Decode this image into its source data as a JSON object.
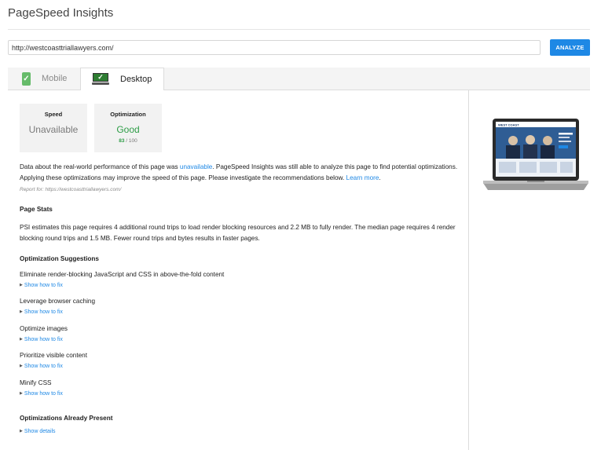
{
  "header": {
    "title": "PageSpeed Insights"
  },
  "search": {
    "url": "http://westcoasttriallawyers.com/",
    "analyze_label": "ANALYZE"
  },
  "tabs": {
    "mobile": "Mobile",
    "desktop": "Desktop"
  },
  "scores": {
    "speed": {
      "title": "Speed",
      "value": "Unavailable"
    },
    "optimization": {
      "title": "Optimization",
      "value": "Good",
      "score": "83",
      "max": "/ 100"
    }
  },
  "intro": {
    "part1": "Data about the real-world performance of this page was ",
    "link1": "unavailable",
    "part2": ". PageSpeed Insights was still able to analyze this page to find potential optimizations. Applying these optimizations may improve the speed of this page. Please investigate the recommendations below. ",
    "link2": "Learn more",
    "part3": "."
  },
  "report_for": "Report for: https://westcoasttriallawyers.com/",
  "page_stats": {
    "heading": "Page Stats",
    "text": "PSI estimates this page requires 4 additional round trips to load render blocking resources and 2.2 MB to fully render. The median page requires 4 render blocking round trips and 1.5 MB. Fewer round trips and bytes results in faster pages."
  },
  "suggestions": {
    "heading": "Optimization Suggestions",
    "show_fix": "Show how to fix",
    "items": [
      "Eliminate render-blocking JavaScript and CSS in above-the-fold content",
      "Leverage browser caching",
      "Optimize images",
      "Prioritize visible content",
      "Minify CSS"
    ]
  },
  "already": {
    "heading": "Optimizations Already Present",
    "show_details": "Show details"
  },
  "preview": {
    "logo_text": "WEST COAST"
  },
  "colors": {
    "accent": "#1e88e5",
    "good": "#2e9d47"
  }
}
